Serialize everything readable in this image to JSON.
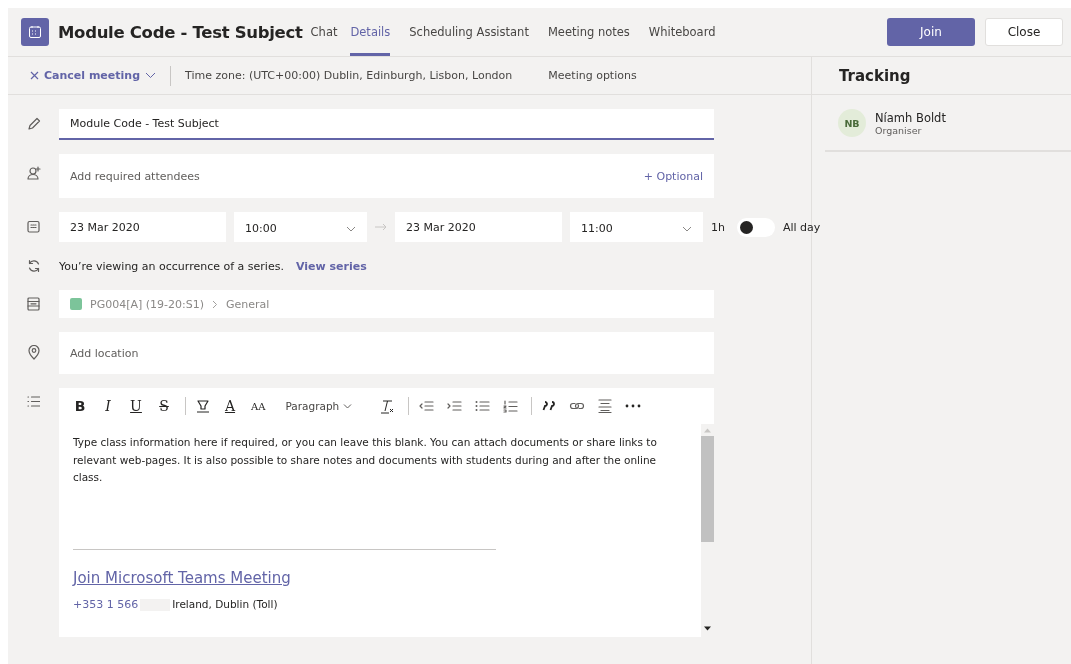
{
  "header": {
    "title": "Module Code - Test Subject",
    "tabs": [
      {
        "label": "Chat",
        "selected": false
      },
      {
        "label": "Details",
        "selected": true
      },
      {
        "label": "Scheduling Assistant",
        "selected": false
      },
      {
        "label": "Meeting notes",
        "selected": false
      },
      {
        "label": "Whiteboard",
        "selected": false
      }
    ],
    "buttons": [
      {
        "label": "Join",
        "kind": "primary"
      },
      {
        "label": "Close",
        "kind": "secondary"
      }
    ]
  },
  "toolbar": {
    "cancel": "Cancel meeting",
    "timezone": "Time zone: (UTC+00:00) Dublin, Edinburgh, Lisbon, London",
    "options": "Meeting options"
  },
  "form": {
    "title_value": "Module Code - Test Subject",
    "attendees_placeholder": "Add required attendees",
    "optional": "+ Optional",
    "start_date": "23 Mar 2020",
    "start_time": "10:00",
    "end_date": "23 Mar 2020",
    "end_time": "11:00",
    "duration": "1h",
    "all_day": {
      "label": "All day",
      "on": false
    },
    "series_note": "You’re viewing an occurrence of a series.",
    "series_link": "View series",
    "channel": {
      "team": "PG004[A] (19-20:S1)",
      "name": "General",
      "color": "#7cc49a"
    },
    "location_placeholder": "Add location"
  },
  "editor": {
    "tools": [
      {
        "kind": "glyph",
        "label": "B"
      },
      {
        "kind": "glyph",
        "label": "I"
      },
      {
        "kind": "glyph",
        "label": "U"
      },
      {
        "kind": "glyph",
        "label": "S"
      },
      {
        "kind": "separator"
      },
      {
        "kind": "icon"
      },
      {
        "kind": "glyph",
        "label": "A"
      },
      {
        "kind": "glyph",
        "label": "AA"
      },
      {
        "kind": "dropdown",
        "label": "Paragraph"
      },
      {
        "kind": "icon"
      },
      {
        "kind": "separator"
      },
      {
        "kind": "icon"
      },
      {
        "kind": "icon"
      },
      {
        "kind": "icon"
      },
      {
        "kind": "icon"
      },
      {
        "kind": "separator"
      },
      {
        "kind": "icon"
      },
      {
        "kind": "icon"
      },
      {
        "kind": "icon"
      },
      {
        "kind": "icon"
      }
    ],
    "body": "Type class information here if required, or you can leave this blank. You can attach documents or share links to relevant web-pages. It is also possible to share notes and documents with students during and after the online class.",
    "link": "Join Microsoft Teams Meeting",
    "phone": "+353 1 566",
    "phone_label": "Ireland, Dublin (Toll)"
  },
  "tracking": {
    "title": "Tracking",
    "people": [
      {
        "initials": "NB",
        "name": "Níamh Boldt",
        "role": "Organiser"
      }
    ]
  }
}
